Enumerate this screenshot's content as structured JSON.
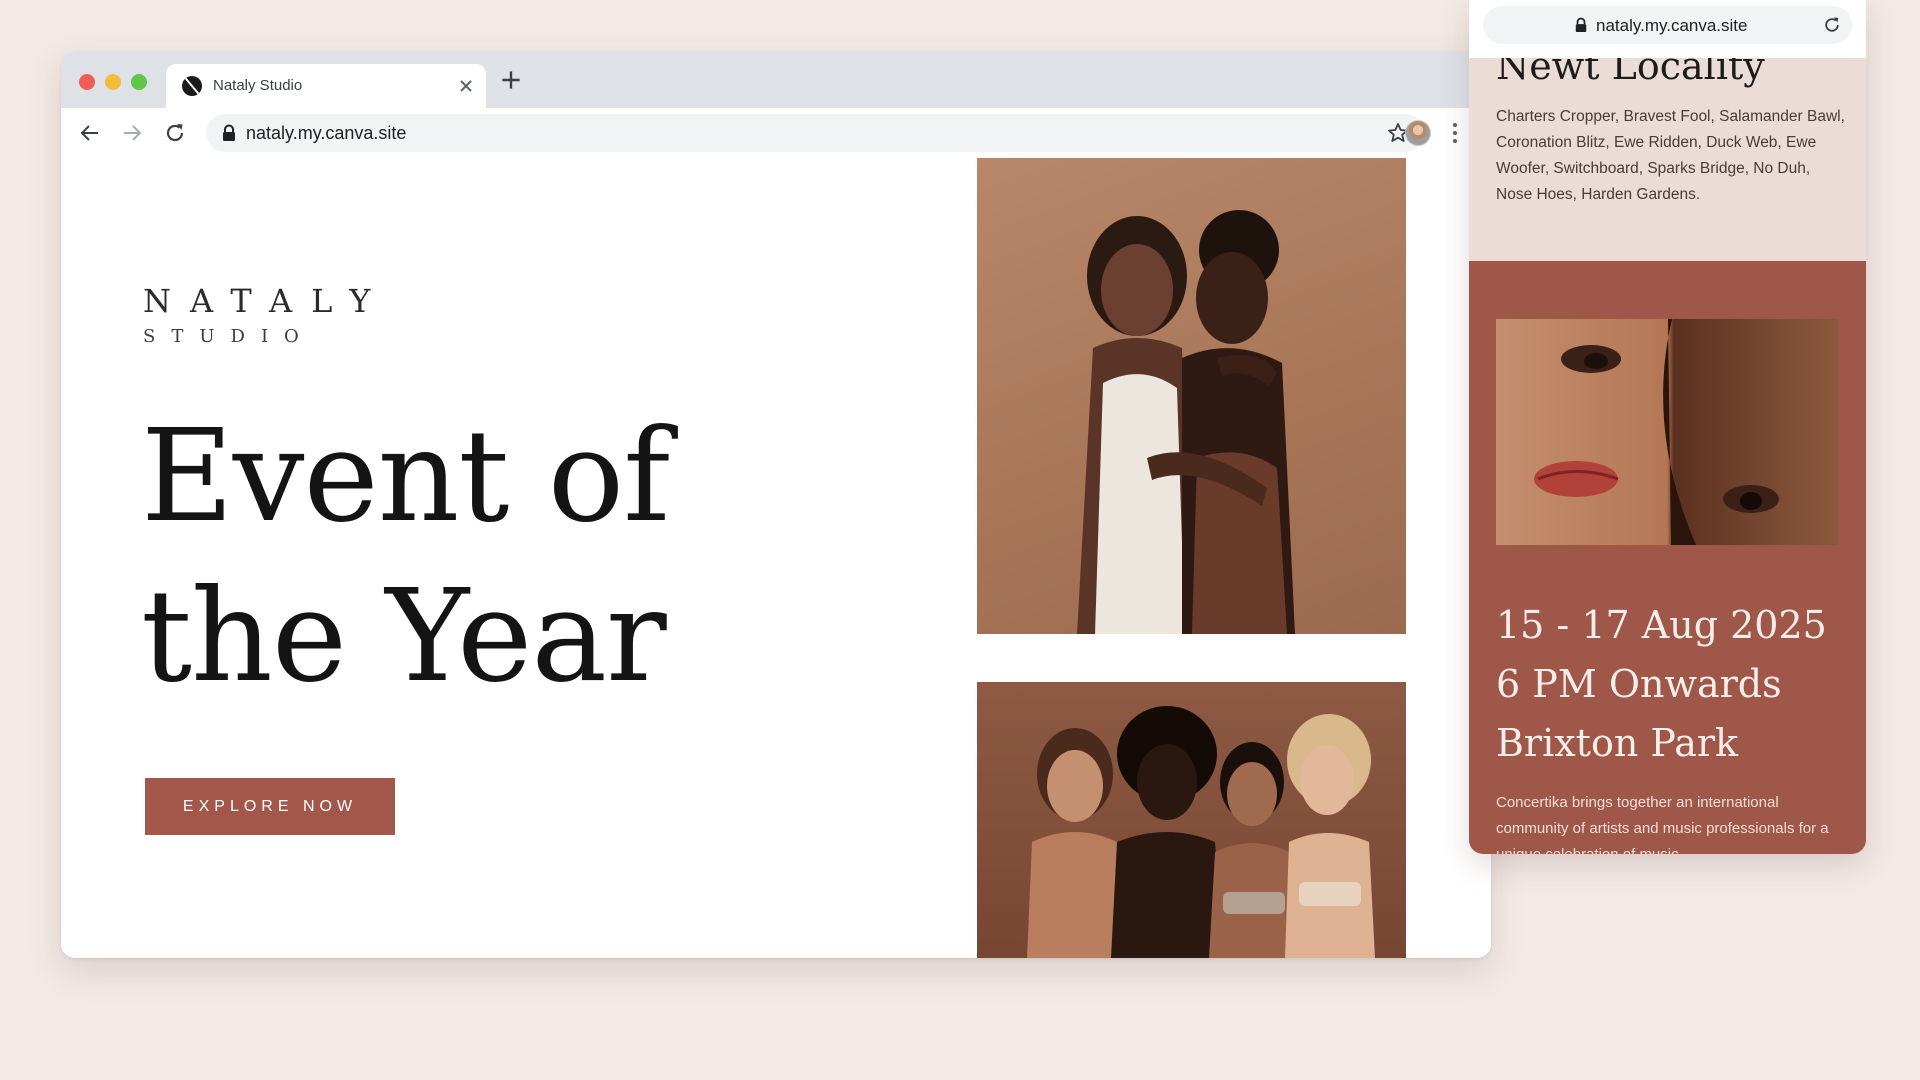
{
  "desktop": {
    "tab": {
      "title": "Nataly Studio"
    },
    "address_bar": {
      "url": "nataly.my.canva.site"
    }
  },
  "site": {
    "brand": {
      "name": "NATALY",
      "subtitle": "STUDIO"
    },
    "headline_line1": "Event of",
    "headline_line2": "the Year",
    "cta_label": "EXPLORE NOW",
    "colors": {
      "accent": "#a3574a",
      "page_bg": "#f3e9e6"
    }
  },
  "mobile": {
    "url": "nataly.my.canva.site",
    "section_title": "Newt Locality",
    "venues": "Charters Cropper, Bravest Fool, Salamander Bawl, Coronation Blitz, Ewe Ridden, Duck Web, Ewe Woofer, Switchboard, Sparks Bridge, No Duh, Nose Hoes, Harden Gardens.",
    "event_dates": "15 - 17 Aug 2025",
    "event_time": "6 PM Onwards",
    "event_location": "Brixton Park",
    "description": "Concertika brings together an international community of artists and music professionals for a unique celebration of music.",
    "colors": {
      "light_section": "#ecdcd7",
      "dark_section": "#9f574a"
    }
  }
}
